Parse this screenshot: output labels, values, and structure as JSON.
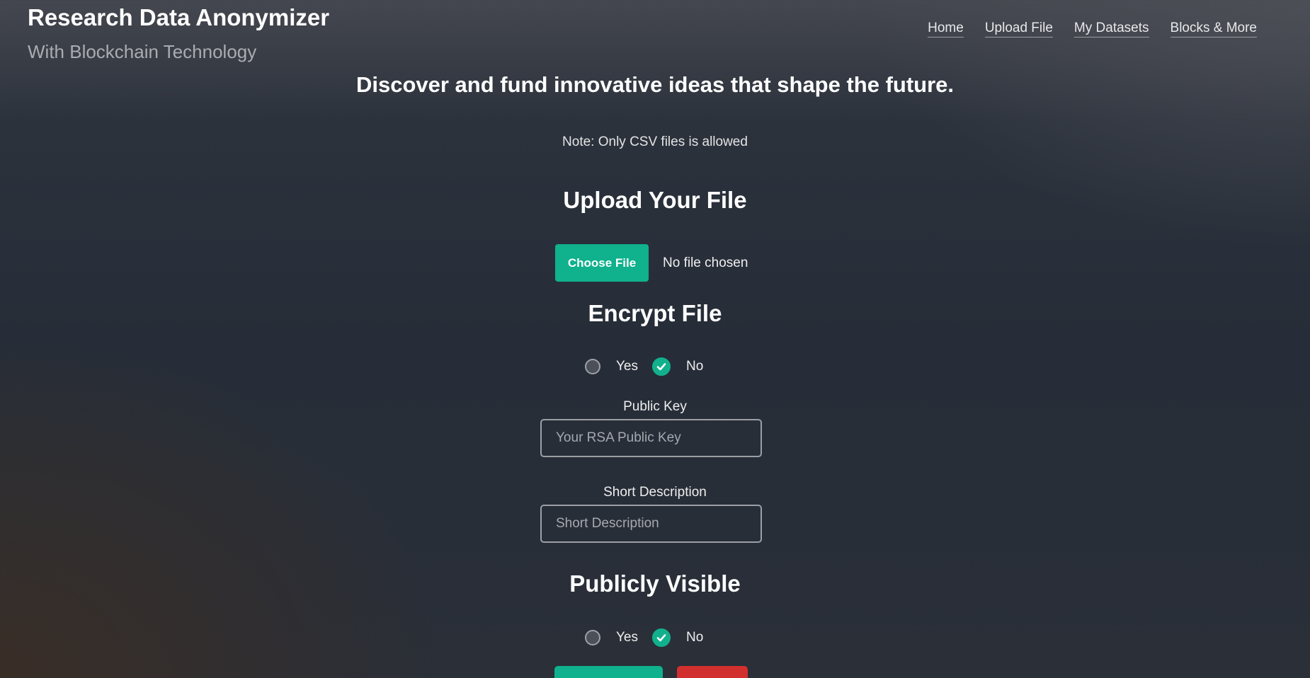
{
  "header": {
    "title": "Research Data Anonymizer",
    "subtitle": "With Blockchain Technology"
  },
  "nav": {
    "items": [
      {
        "label": "Home"
      },
      {
        "label": "Upload File"
      },
      {
        "label": "My Datasets"
      },
      {
        "label": "Blocks & More"
      }
    ]
  },
  "main": {
    "hero": "Discover and fund innovative ideas that shape the future.",
    "note": "Note: Only CSV files is allowed",
    "upload": {
      "heading": "Upload Your File",
      "button_label": "Choose File",
      "status": "No file chosen"
    },
    "encrypt": {
      "heading": "Encrypt File",
      "options": [
        {
          "label": "Yes",
          "checked": false
        },
        {
          "label": "No",
          "checked": true
        }
      ]
    },
    "public_key": {
      "label": "Public Key",
      "placeholder": "Your RSA Public Key",
      "value": ""
    },
    "short_description": {
      "label": "Short Description",
      "placeholder": "Short Description",
      "value": ""
    },
    "visibility": {
      "heading": "Publicly Visible",
      "options": [
        {
          "label": "Yes",
          "checked": false
        },
        {
          "label": "No",
          "checked": true
        }
      ]
    }
  },
  "colors": {
    "accent": "#10b18d",
    "danger": "#d2302f"
  }
}
